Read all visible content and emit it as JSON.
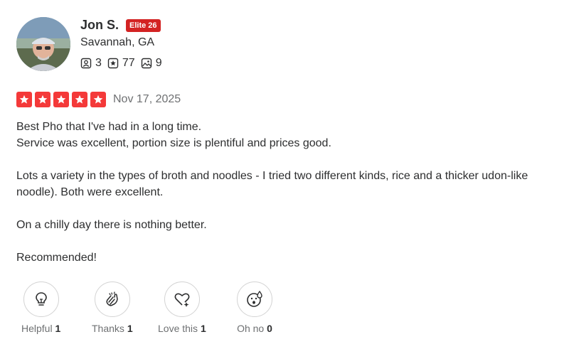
{
  "user": {
    "name": "Jon S.",
    "badge": "Elite 26",
    "location": "Savannah, GA",
    "stats": [
      {
        "icon": "friends-icon",
        "value": "3"
      },
      {
        "icon": "reviews-icon",
        "value": "77"
      },
      {
        "icon": "photos-icon",
        "value": "9"
      }
    ]
  },
  "review": {
    "rating": 5,
    "date": "Nov 17, 2025",
    "paragraphs": [
      "Best Pho that I've had in a long time.",
      "Service was excellent, portion size is plentiful and prices good.",
      "Lots a variety in the types of broth and noodles - I tried two different kinds, rice and a thicker udon-like noodle). Both were excellent.",
      "On a chilly day there is nothing better.",
      "Recommended!"
    ]
  },
  "reactions": [
    {
      "icon": "lightbulb-icon",
      "label": "Helpful",
      "count": "1"
    },
    {
      "icon": "clapping-hands-icon",
      "label": "Thanks",
      "count": "1"
    },
    {
      "icon": "heart-icon",
      "label": "Love this",
      "count": "1"
    },
    {
      "icon": "oh-no-face-icon",
      "label": "Oh no",
      "count": "0"
    }
  ],
  "colors": {
    "star": "#f43939",
    "elite": "#d32323",
    "muted": "#6e7072"
  }
}
